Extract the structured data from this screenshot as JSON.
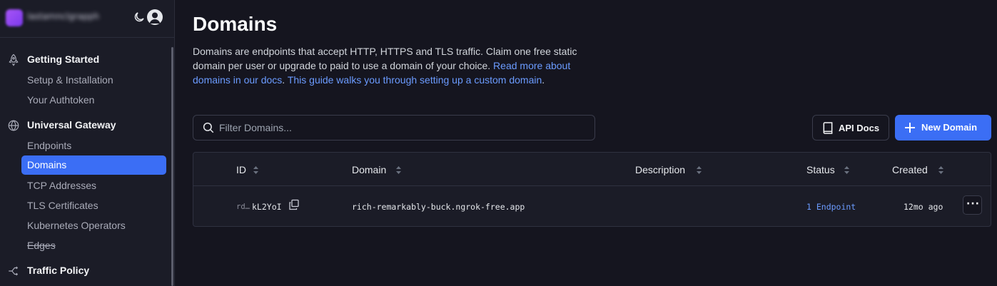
{
  "account": {
    "name": "lastamnclgrapph",
    "theme_icon": "moon-icon",
    "user_icon": "user-avatar-icon"
  },
  "sidebar": {
    "sections": [
      {
        "label": "Getting Started",
        "icon": "rocket-icon"
      },
      {
        "label": "Universal Gateway",
        "icon": "globe-icon"
      },
      {
        "label": "Traffic Policy",
        "icon": "traffic-policy-icon"
      }
    ],
    "items": [
      {
        "label": "Setup & Installation"
      },
      {
        "label": "Your Authtoken"
      },
      {
        "label": "Endpoints"
      },
      {
        "label": "Domains",
        "active": true
      },
      {
        "label": "TCP Addresses"
      },
      {
        "label": "TLS Certificates"
      },
      {
        "label": "Kubernetes Operators"
      },
      {
        "label": "Edges",
        "deprecated": true
      }
    ]
  },
  "page": {
    "title": "Domains",
    "desc_text": "Domains are endpoints that accept HTTP, HTTPS and TLS traffic. Claim one free static domain per user or upgrade to paid to use a domain of your choice. ",
    "desc_link1": "Read more about domains in our docs",
    "desc_sep": ". ",
    "desc_link2": "This guide walks you through setting up a custom domain",
    "desc_end": "."
  },
  "toolbar": {
    "filter_placeholder": "Filter Domains...",
    "api_docs_label": "API Docs",
    "new_domain_label": "New Domain"
  },
  "table": {
    "columns": [
      "ID",
      "Domain",
      "Description",
      "Status",
      "Created"
    ],
    "rows": [
      {
        "id_prefix": "rd…",
        "id_suffix": "kL2YoI",
        "domain": "rich-remarkably-buck.ngrok-free.app",
        "description": "",
        "status": "1 Endpoint",
        "created": "12mo ago"
      }
    ],
    "row_menu": "···"
  },
  "colors": {
    "accent": "#3b6ef5",
    "link": "#6b9bff",
    "bg": "#15151f",
    "panel": "#1b1c27"
  }
}
